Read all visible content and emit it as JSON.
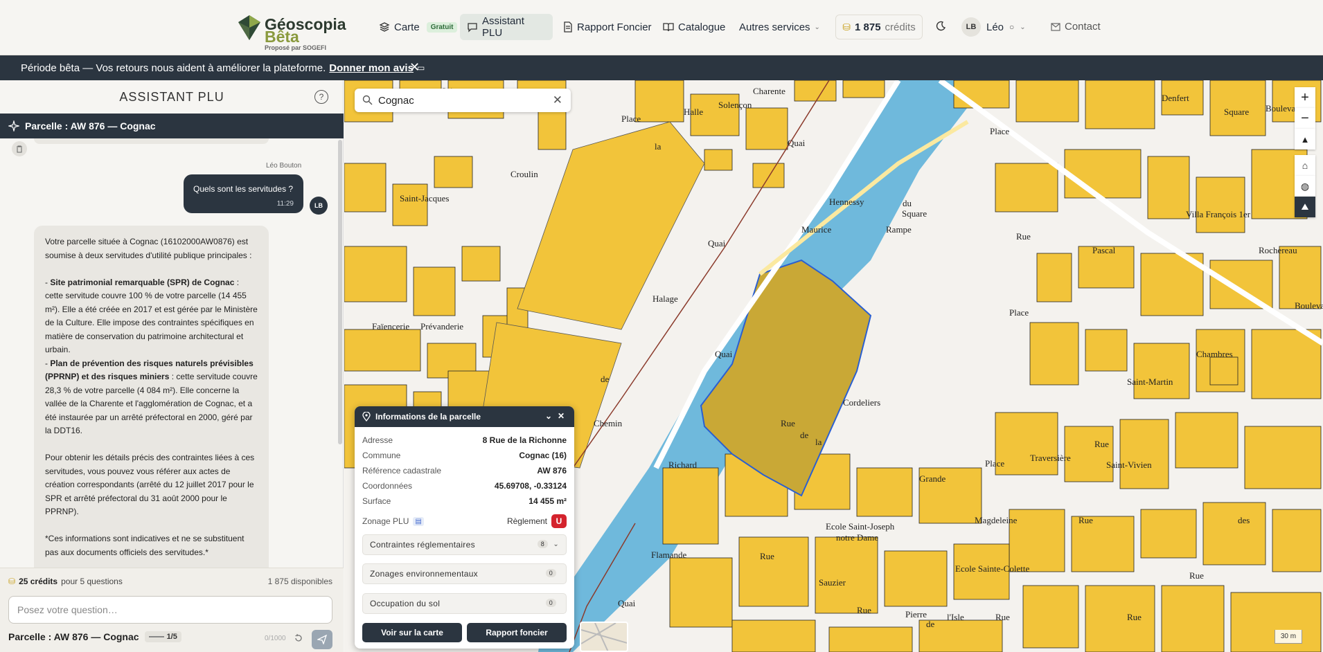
{
  "brand": {
    "name_line1": "Géoscopia",
    "name_line2": "Bêta",
    "tagline": "Proposé par SOGEFI"
  },
  "nav": {
    "items": [
      {
        "label": "Carte",
        "badge": "Gratuit"
      },
      {
        "label": "Assistant PLU"
      },
      {
        "label": "Rapport Foncier"
      },
      {
        "label": "Catalogue"
      },
      {
        "label": "Autres services"
      }
    ],
    "credits_value": "1 875",
    "credits_label": "crédits",
    "user_initials": "LB",
    "user_name": "Léo",
    "contact": "Contact"
  },
  "beta_banner": {
    "text": "Période bêta — Vos retours nous aident à améliorer la plateforme.",
    "link": "Donner mon avis"
  },
  "panel": {
    "title": "ASSISTANT PLU",
    "parcel_context": "Parcelle : AW 876 — Cognac",
    "messages": {
      "user_name": "Léo Bouton",
      "user_text": "Quels sont les servitudes ?",
      "user_time": "11:29",
      "user_initials": "LB",
      "assistant": {
        "intro": "Votre parcelle située à Cognac (16102000AW0876) est soumise à deux servitudes d'utilité publique principales :",
        "item1_title": "Site patrimonial remarquable (SPR) de Cognac",
        "item1_text": " : cette servitude couvre 100 % de votre parcelle (14 455 m²). Elle a été créée en 2017 et est gérée par le Ministère de la Culture. Elle impose des contraintes spécifiques en matière de conservation du patrimoine architectural et urbain.",
        "item2_title": "Plan de prévention des risques naturels prévisibles (PPRNP) et des risques miniers",
        "item2_text": " : cette servitude couvre 28,3 % de votre parcelle (4 084 m²). Elle concerne la vallée de la Charente et l'agglomération de Cognac, et a été instaurée par un arrêté préfectoral en 2000, géré par la DDT16.",
        "para3": "Pour obtenir les détails précis des contraintes liées à ces servitudes, vous pouvez vous référer aux actes de création correspondants (arrêté du 12 juillet 2017 pour le SPR et arrêté préfectoral du 31 août 2000 pour le PPRNP).",
        "para4": "*Ces informations sont indicatives et ne se substituent pas aux documents officiels des servitudes.*"
      }
    },
    "footer": {
      "cost": "25 crédits",
      "cost_suffix": "pour 5 questions",
      "available": "1 875 disponibles",
      "input_placeholder": "Posez votre question…",
      "context": "Parcelle : AW 876 — Cognac",
      "pager": "1/5",
      "char_count": "0/1000"
    }
  },
  "map": {
    "search_value": "Cognac",
    "scale": "30 m",
    "labels": [
      "Square",
      "Boulevard",
      "Place",
      "Square",
      "Denfert",
      "Villa François 1er",
      "Quai",
      "Hennessy",
      "Place",
      "Rampe",
      "du",
      "Rue",
      "Maurice",
      "Quai",
      "Rue",
      "de",
      "la",
      "Richard",
      "Cordeliers",
      "Chemin",
      "de",
      "Halage",
      "Quai",
      "Saint-Jacques",
      "Prévanderie",
      "Faïencerie",
      "Croulin",
      "Place",
      "la",
      "Halle",
      "Solençon",
      "Charente",
      "Saint",
      "Ecole Saint-Joseph",
      "notre Dame",
      "Ecole Sainte-Colette",
      "Rue",
      "Sauzier",
      "Magdeleine",
      "Grande",
      "Place",
      "Traversière",
      "Rue",
      "Saint-Vivien",
      "Rue",
      "Pierre",
      "de",
      "l'Isle",
      "Rue",
      "Flamande",
      "Quai",
      "Rue",
      "Rue",
      "Rue",
      "des",
      "Boulevard",
      "Rochereau",
      "Chambres",
      "Pascal",
      "Saint-Martin"
    ]
  },
  "parcel_info": {
    "title": "Informations de la parcelle",
    "rows": [
      {
        "k": "Adresse",
        "v": "8 Rue de la Richonne"
      },
      {
        "k": "Commune",
        "v": "Cognac (16)"
      },
      {
        "k": "Référence cadastrale",
        "v": "AW 876"
      },
      {
        "k": "Coordonnées",
        "v": "45.69708, -0.33124"
      },
      {
        "k": "Surface",
        "v": "14 455 m²"
      }
    ],
    "zoning_label": "Zonage PLU",
    "reglement_label": "Règlement",
    "zone": "U",
    "sections": [
      {
        "label": "Contraintes réglementaires",
        "count": "8"
      },
      {
        "label": "Zonages environnementaux",
        "count": "0"
      },
      {
        "label": "Occupation du sol",
        "count": "0"
      }
    ],
    "btn_map": "Voir sur la carte",
    "btn_report": "Rapport foncier"
  }
}
